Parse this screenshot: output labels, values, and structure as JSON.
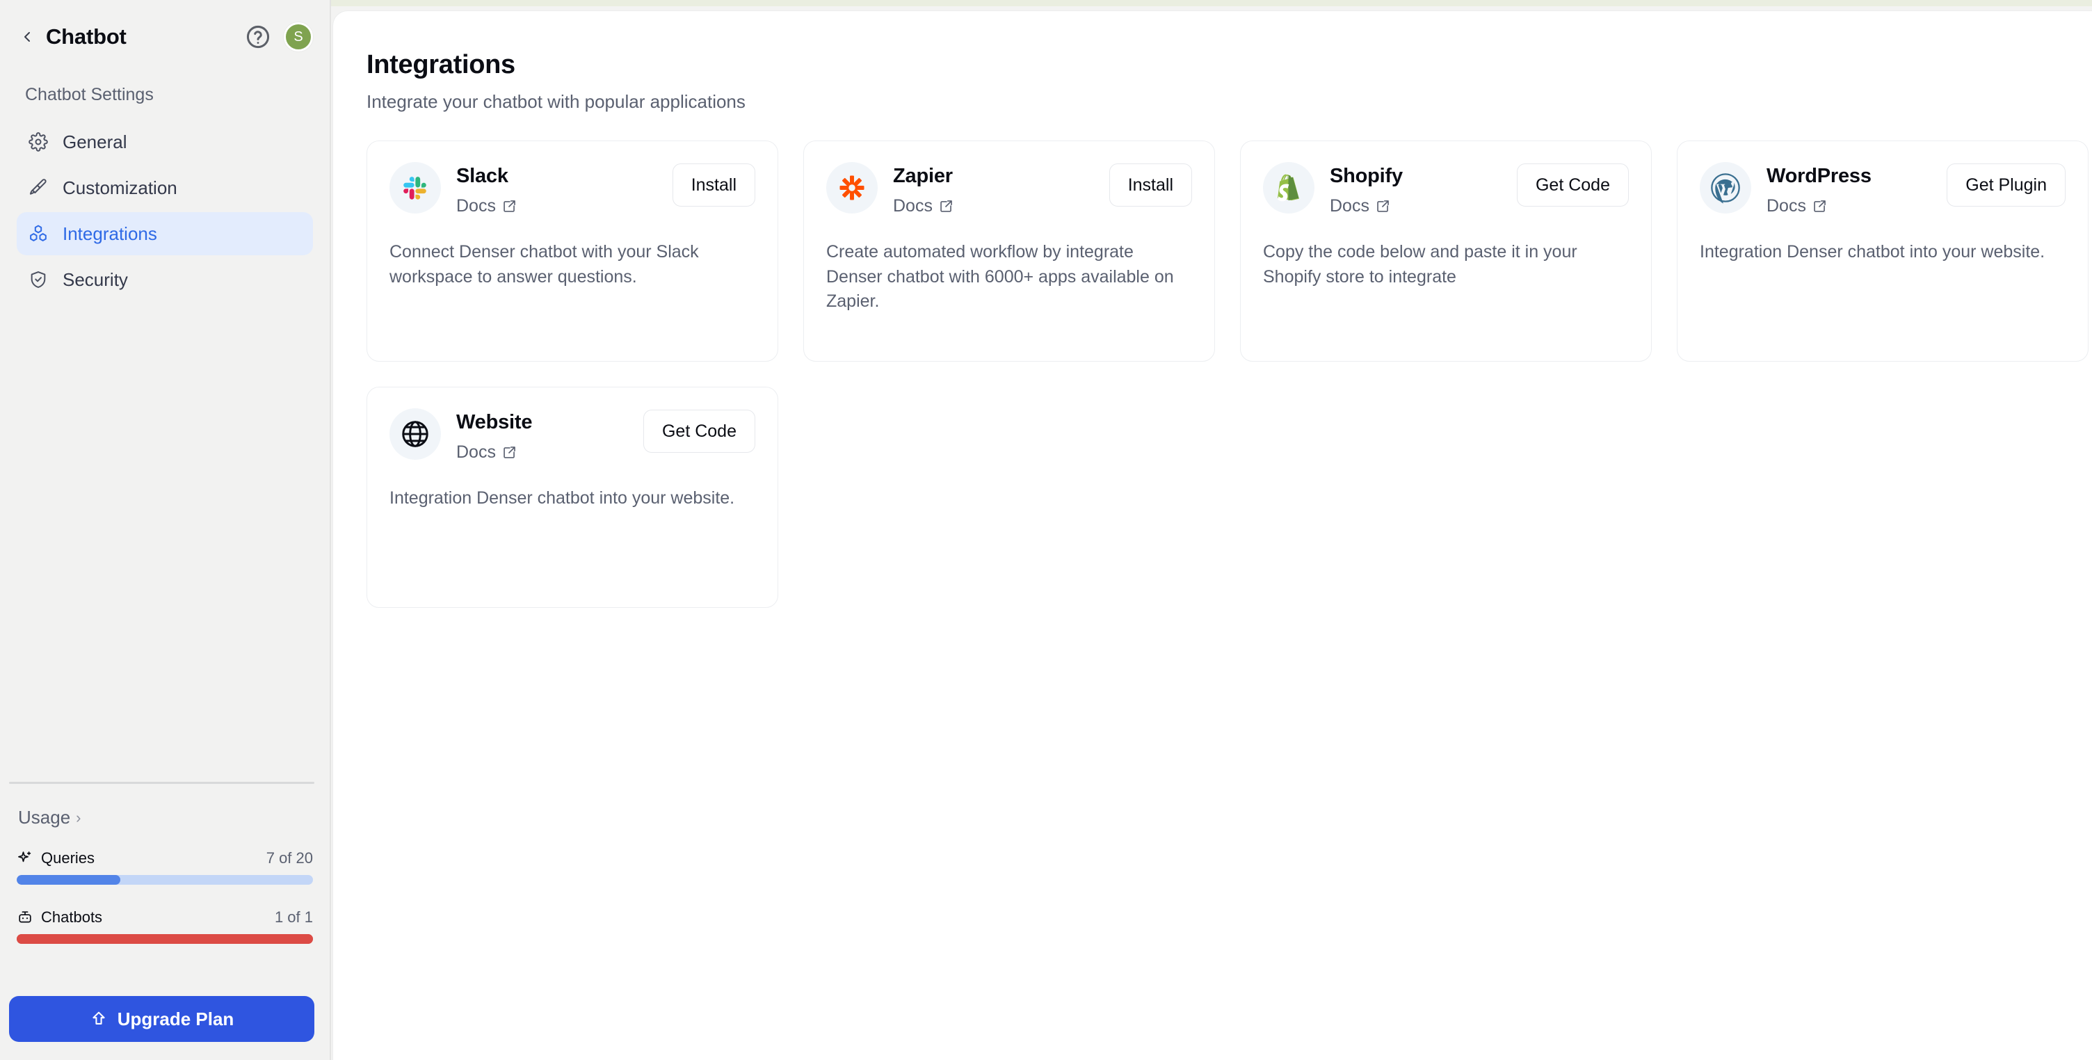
{
  "sidebar": {
    "back_icon": "chevron-left-icon",
    "title": "Chatbot",
    "help_icon": "help-circle-icon",
    "avatar_initial": "S",
    "avatar_color": "#7fa34f",
    "section_label": "Chatbot Settings",
    "nav": [
      {
        "label": "General",
        "icon": "gear-icon",
        "active": false
      },
      {
        "label": "Customization",
        "icon": "paintbrush-icon",
        "active": false
      },
      {
        "label": "Integrations",
        "icon": "blocks-icon",
        "active": true
      },
      {
        "label": "Security",
        "icon": "shield-check-icon",
        "active": false
      }
    ],
    "active_color": "#2f6ae6",
    "active_bg": "#e3ecfd",
    "usage": {
      "label": "Usage",
      "chevron": "›",
      "meters": [
        {
          "label": "Queries",
          "icon": "sparkle-icon",
          "value": "7 of 20",
          "percent": 35,
          "color": "#5284e8",
          "track": "#c3d6f7"
        },
        {
          "label": "Chatbots",
          "icon": "robot-icon",
          "value": "1 of 1",
          "percent": 100,
          "color": "#dc4b45",
          "track": "#dc4b45"
        }
      ]
    },
    "upgrade": {
      "label": "Upgrade Plan",
      "icon": "arrow-up-icon",
      "color": "#2f55e0"
    }
  },
  "main": {
    "title": "Integrations",
    "subtitle": "Integrate your chatbot with popular applications",
    "docs_label": "Docs",
    "docs_icon": "external-link-icon",
    "cards": [
      {
        "name": "Slack",
        "logo": "slack-logo",
        "action": "Install",
        "description": "Connect Denser chatbot with your Slack workspace to answer questions."
      },
      {
        "name": "Zapier",
        "logo": "zapier-logo",
        "action": "Install",
        "description": "Create automated workflow by integrate Denser chatbot with 6000+ apps available on Zapier."
      },
      {
        "name": "Shopify",
        "logo": "shopify-logo",
        "action": "Get Code",
        "description": "Copy the code below and paste it in your Shopify store to integrate"
      },
      {
        "name": "WordPress",
        "logo": "wordpress-logo",
        "action": "Get Plugin",
        "description": "Integration Denser chatbot into your website."
      },
      {
        "name": "Website",
        "logo": "globe-logo",
        "action": "Get Code",
        "description": "Integration Denser chatbot into your website."
      }
    ]
  }
}
